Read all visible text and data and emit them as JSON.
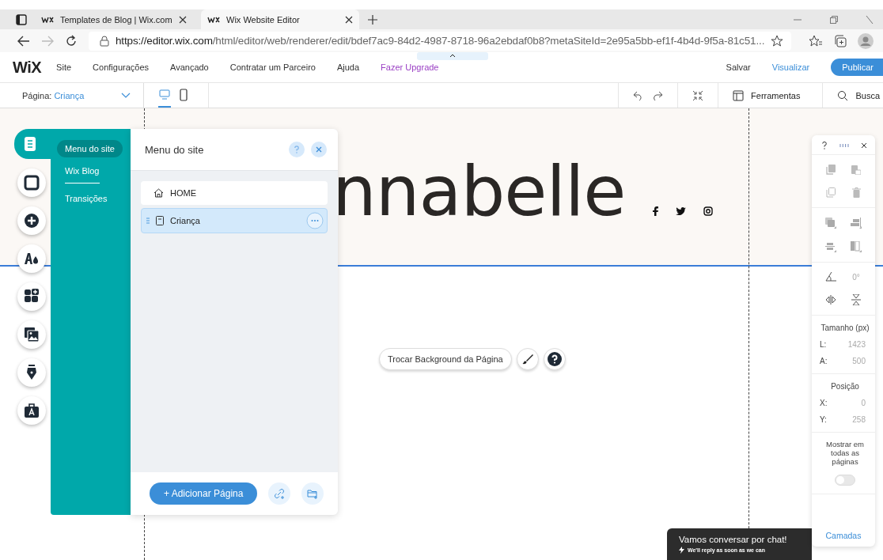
{
  "browser": {
    "tabs": [
      {
        "title": "Templates de Blog | Wix.com",
        "selected": false
      },
      {
        "title": "Wix Website Editor",
        "selected": true
      }
    ],
    "url_host": "https://editor.wix.com",
    "url_path": "/html/editor/web/renderer/edit/bdef7ac9-84d2-4987-8718-96a2ebdaf0b8?metaSiteId=2e95a5bb-ef1f-4b4d-9f5a-81c51..."
  },
  "topbar": {
    "logo": "WiX",
    "menu": [
      {
        "label": "Site",
        "kind": "plain"
      },
      {
        "label": "Configurações",
        "kind": "plain"
      },
      {
        "label": "Avançado",
        "kind": "plain"
      },
      {
        "label": "Contratar um Parceiro",
        "kind": "plain"
      },
      {
        "label": "Ajuda",
        "kind": "plain"
      },
      {
        "label": "Fazer Upgrade",
        "kind": "upgrade"
      }
    ],
    "save": "Salvar",
    "preview": "Visualizar",
    "publish": "Publicar"
  },
  "pagebar": {
    "label": "Página:",
    "page": "Criança",
    "views": [
      {
        "kind": "desktop",
        "selected": true
      },
      {
        "kind": "mobile",
        "selected": false
      }
    ],
    "tools": "Ferramentas",
    "search": "Busca"
  },
  "left_tools": [
    {
      "kind": "pages",
      "selected": true
    },
    {
      "kind": "background",
      "selected": false
    },
    {
      "kind": "add",
      "selected": false
    },
    {
      "kind": "design",
      "selected": false
    },
    {
      "kind": "apps",
      "selected": false
    },
    {
      "kind": "media",
      "selected": false
    },
    {
      "kind": "blog",
      "selected": false
    },
    {
      "kind": "business",
      "selected": false
    }
  ],
  "menu_panel": {
    "nav": [
      {
        "label": "Menu do site",
        "selected": true
      },
      {
        "label": "Wix Blog",
        "selected": false
      },
      {
        "label": "Transições",
        "selected": false
      }
    ],
    "title": "Menu do site",
    "pages": [
      {
        "label": "HOME",
        "kind": "home",
        "selected": false
      },
      {
        "label": "Criança",
        "kind": "page",
        "selected": true
      }
    ],
    "add_button": "+ Adicionar Página"
  },
  "site": {
    "heading": "nnabelle",
    "bg_button": "Trocar Background da Página"
  },
  "props_panel": {
    "rotation": "0°",
    "size_title": "Tamanho (px)",
    "size": [
      {
        "label": "L:",
        "value": "1423"
      },
      {
        "label": "A:",
        "value": "500"
      }
    ],
    "position_title": "Posição",
    "position": [
      {
        "label": "X:",
        "value": "0"
      },
      {
        "label": "Y:",
        "value": "258"
      }
    ],
    "show_all": "Mostrar em todas as páginas",
    "show_all_on": false,
    "layers": "Camadas"
  },
  "chat": {
    "title": "Vamos conversar por chat!",
    "subtitle": "We'll reply as soon as we can"
  }
}
